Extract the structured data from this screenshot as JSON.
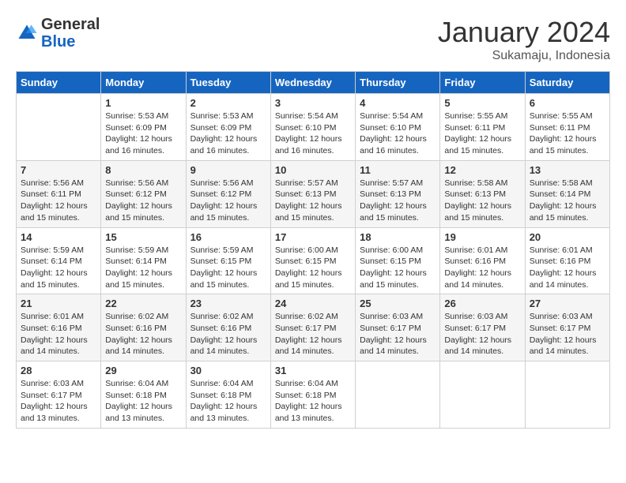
{
  "header": {
    "logo_general": "General",
    "logo_blue": "Blue",
    "month_year": "January 2024",
    "location": "Sukamaju, Indonesia"
  },
  "columns": [
    "Sunday",
    "Monday",
    "Tuesday",
    "Wednesday",
    "Thursday",
    "Friday",
    "Saturday"
  ],
  "weeks": [
    [
      {
        "num": "",
        "info": ""
      },
      {
        "num": "1",
        "info": "Sunrise: 5:53 AM\nSunset: 6:09 PM\nDaylight: 12 hours\nand 16 minutes."
      },
      {
        "num": "2",
        "info": "Sunrise: 5:53 AM\nSunset: 6:09 PM\nDaylight: 12 hours\nand 16 minutes."
      },
      {
        "num": "3",
        "info": "Sunrise: 5:54 AM\nSunset: 6:10 PM\nDaylight: 12 hours\nand 16 minutes."
      },
      {
        "num": "4",
        "info": "Sunrise: 5:54 AM\nSunset: 6:10 PM\nDaylight: 12 hours\nand 16 minutes."
      },
      {
        "num": "5",
        "info": "Sunrise: 5:55 AM\nSunset: 6:11 PM\nDaylight: 12 hours\nand 15 minutes."
      },
      {
        "num": "6",
        "info": "Sunrise: 5:55 AM\nSunset: 6:11 PM\nDaylight: 12 hours\nand 15 minutes."
      }
    ],
    [
      {
        "num": "7",
        "info": "Sunrise: 5:56 AM\nSunset: 6:11 PM\nDaylight: 12 hours\nand 15 minutes."
      },
      {
        "num": "8",
        "info": "Sunrise: 5:56 AM\nSunset: 6:12 PM\nDaylight: 12 hours\nand 15 minutes."
      },
      {
        "num": "9",
        "info": "Sunrise: 5:56 AM\nSunset: 6:12 PM\nDaylight: 12 hours\nand 15 minutes."
      },
      {
        "num": "10",
        "info": "Sunrise: 5:57 AM\nSunset: 6:13 PM\nDaylight: 12 hours\nand 15 minutes."
      },
      {
        "num": "11",
        "info": "Sunrise: 5:57 AM\nSunset: 6:13 PM\nDaylight: 12 hours\nand 15 minutes."
      },
      {
        "num": "12",
        "info": "Sunrise: 5:58 AM\nSunset: 6:13 PM\nDaylight: 12 hours\nand 15 minutes."
      },
      {
        "num": "13",
        "info": "Sunrise: 5:58 AM\nSunset: 6:14 PM\nDaylight: 12 hours\nand 15 minutes."
      }
    ],
    [
      {
        "num": "14",
        "info": "Sunrise: 5:59 AM\nSunset: 6:14 PM\nDaylight: 12 hours\nand 15 minutes."
      },
      {
        "num": "15",
        "info": "Sunrise: 5:59 AM\nSunset: 6:14 PM\nDaylight: 12 hours\nand 15 minutes."
      },
      {
        "num": "16",
        "info": "Sunrise: 5:59 AM\nSunset: 6:15 PM\nDaylight: 12 hours\nand 15 minutes."
      },
      {
        "num": "17",
        "info": "Sunrise: 6:00 AM\nSunset: 6:15 PM\nDaylight: 12 hours\nand 15 minutes."
      },
      {
        "num": "18",
        "info": "Sunrise: 6:00 AM\nSunset: 6:15 PM\nDaylight: 12 hours\nand 15 minutes."
      },
      {
        "num": "19",
        "info": "Sunrise: 6:01 AM\nSunset: 6:16 PM\nDaylight: 12 hours\nand 14 minutes."
      },
      {
        "num": "20",
        "info": "Sunrise: 6:01 AM\nSunset: 6:16 PM\nDaylight: 12 hours\nand 14 minutes."
      }
    ],
    [
      {
        "num": "21",
        "info": "Sunrise: 6:01 AM\nSunset: 6:16 PM\nDaylight: 12 hours\nand 14 minutes."
      },
      {
        "num": "22",
        "info": "Sunrise: 6:02 AM\nSunset: 6:16 PM\nDaylight: 12 hours\nand 14 minutes."
      },
      {
        "num": "23",
        "info": "Sunrise: 6:02 AM\nSunset: 6:16 PM\nDaylight: 12 hours\nand 14 minutes."
      },
      {
        "num": "24",
        "info": "Sunrise: 6:02 AM\nSunset: 6:17 PM\nDaylight: 12 hours\nand 14 minutes."
      },
      {
        "num": "25",
        "info": "Sunrise: 6:03 AM\nSunset: 6:17 PM\nDaylight: 12 hours\nand 14 minutes."
      },
      {
        "num": "26",
        "info": "Sunrise: 6:03 AM\nSunset: 6:17 PM\nDaylight: 12 hours\nand 14 minutes."
      },
      {
        "num": "27",
        "info": "Sunrise: 6:03 AM\nSunset: 6:17 PM\nDaylight: 12 hours\nand 14 minutes."
      }
    ],
    [
      {
        "num": "28",
        "info": "Sunrise: 6:03 AM\nSunset: 6:17 PM\nDaylight: 12 hours\nand 13 minutes."
      },
      {
        "num": "29",
        "info": "Sunrise: 6:04 AM\nSunset: 6:18 PM\nDaylight: 12 hours\nand 13 minutes."
      },
      {
        "num": "30",
        "info": "Sunrise: 6:04 AM\nSunset: 6:18 PM\nDaylight: 12 hours\nand 13 minutes."
      },
      {
        "num": "31",
        "info": "Sunrise: 6:04 AM\nSunset: 6:18 PM\nDaylight: 12 hours\nand 13 minutes."
      },
      {
        "num": "",
        "info": ""
      },
      {
        "num": "",
        "info": ""
      },
      {
        "num": "",
        "info": ""
      }
    ]
  ]
}
